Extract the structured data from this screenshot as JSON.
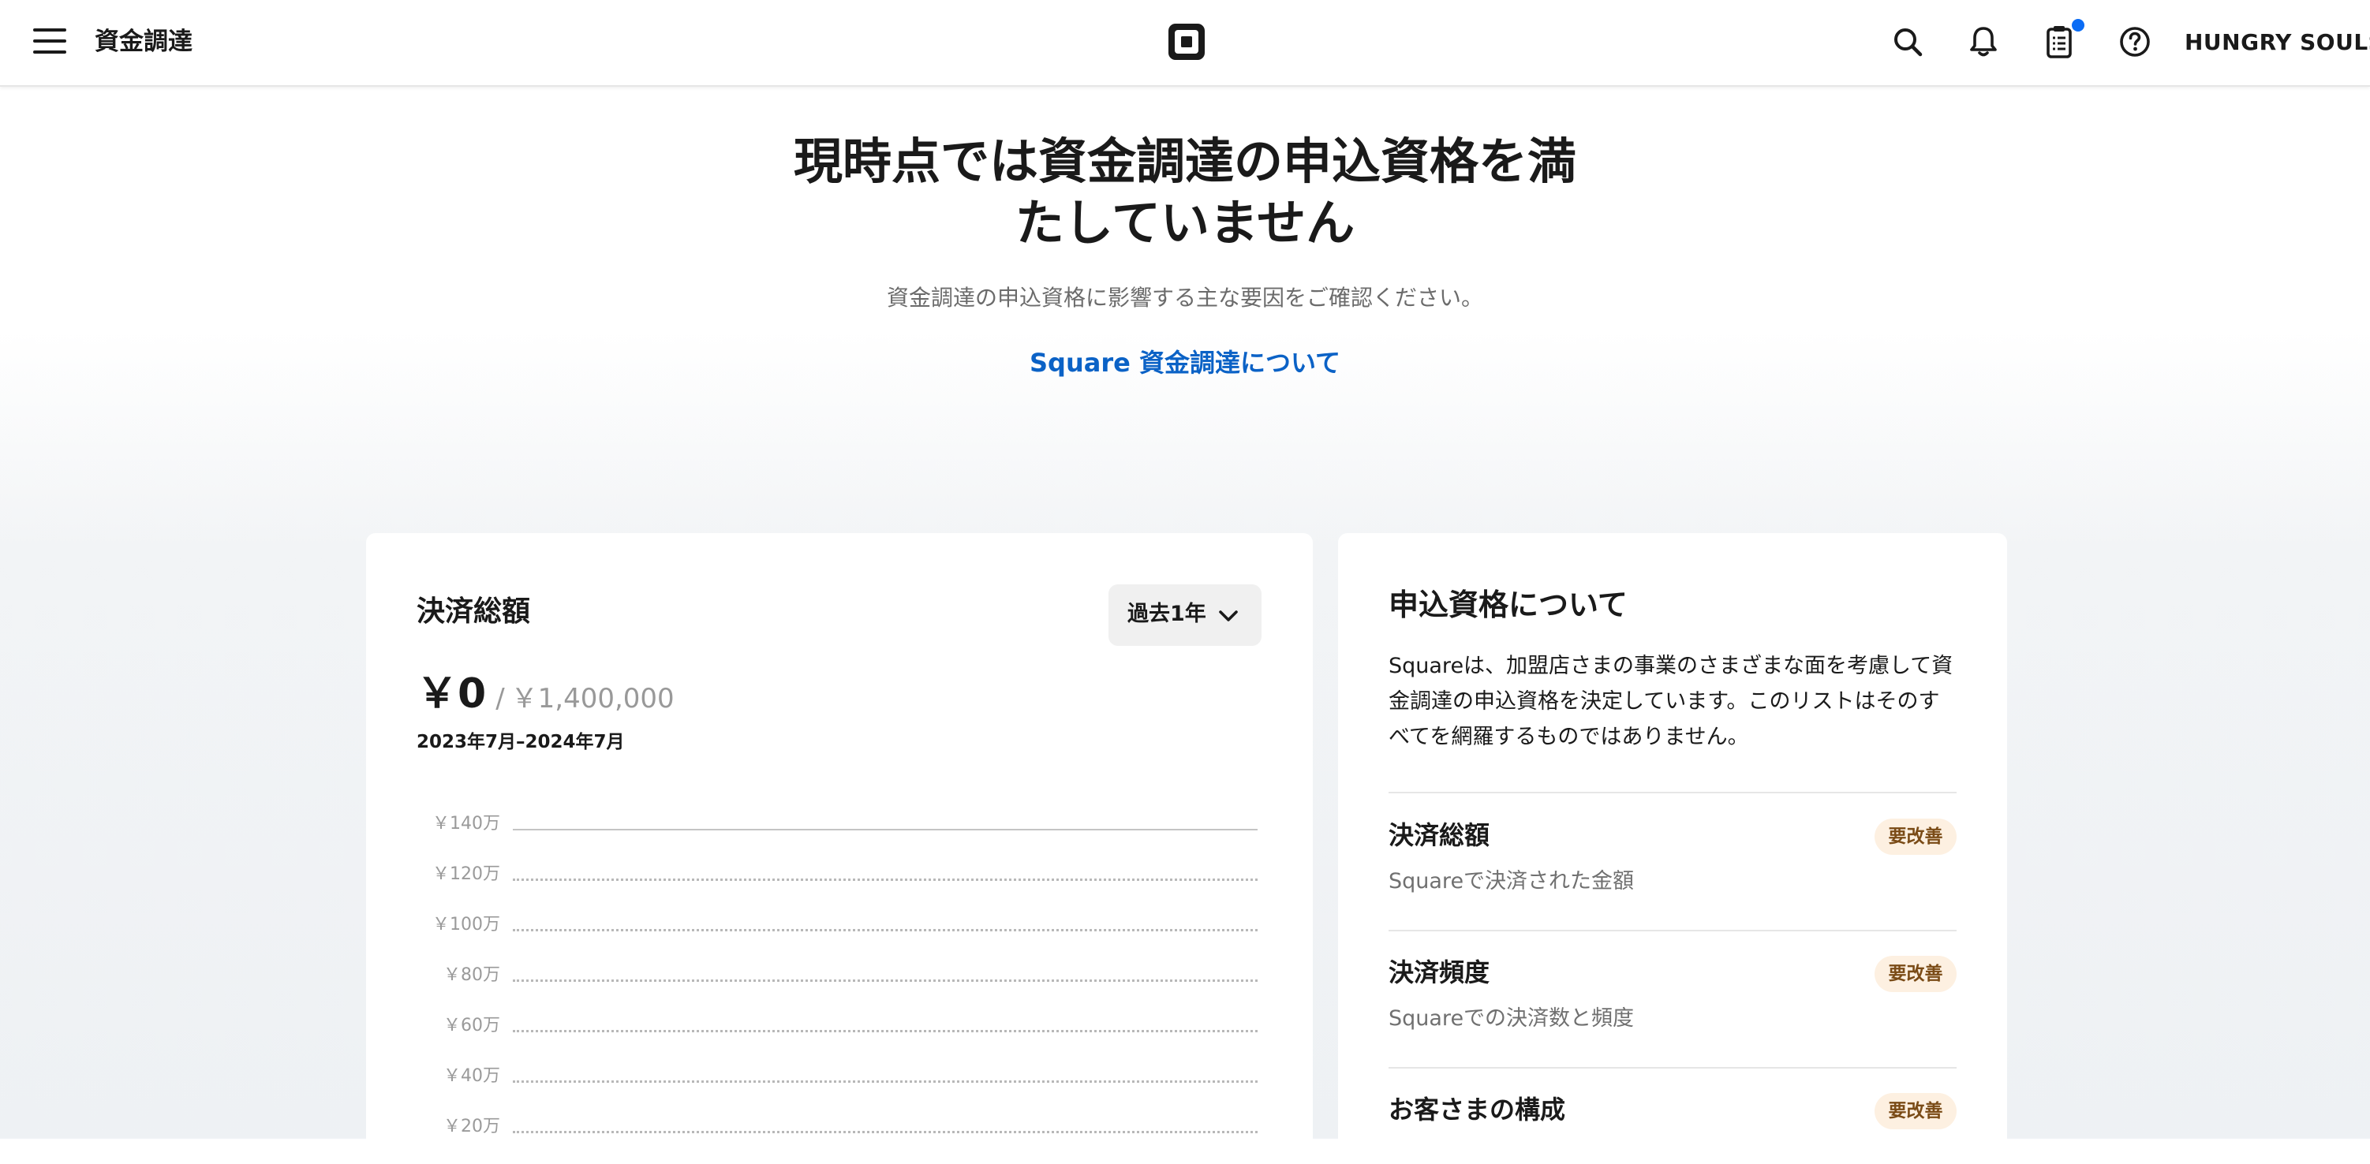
{
  "header": {
    "title": "資金調達",
    "account_name": "HUNGRY SOULS",
    "icons": [
      "menu-icon",
      "square-logo",
      "search-icon",
      "bell-icon",
      "clipboard-icon",
      "help-icon"
    ],
    "notification_dot_color": "#0a6cf5"
  },
  "hero": {
    "title_line1": "現時点では資金調達の申込資格を満",
    "title_line2": "たしていません",
    "subtitle": "資金調達の申込資格に影響する主な要因をご確認ください。",
    "link": "Square 資金調達について",
    "link_color": "#0b62c6"
  },
  "payments_card": {
    "title": "決済総額",
    "period_selector": "過去1年",
    "amount": "￥0",
    "separator": "/",
    "goal": "￥1,400,000",
    "date_range": "2023年7月–2024年7月",
    "y_axis_labels": [
      "￥140万",
      "￥120万",
      "￥100万",
      "￥80万",
      "￥60万",
      "￥40万",
      "￥20万"
    ]
  },
  "eligibility_card": {
    "title": "申込資格について",
    "description": "Squareは、加盟店さまの事業のさまざまな面を考慮して資金調達の申込資格を決定しています。このリストはそのすべてを網羅するものではありません。",
    "items": [
      {
        "title": "決済総額",
        "description": "Squareで決済された金額",
        "badge": "要改善"
      },
      {
        "title": "決済頻度",
        "description": "Squareでの決済数と頻度",
        "badge": "要改善"
      },
      {
        "title": "お客さまの構成",
        "description": "",
        "badge": "要改善"
      }
    ],
    "badge_colors": {
      "background": "#fdf0e1",
      "text": "#7a4b16"
    }
  }
}
